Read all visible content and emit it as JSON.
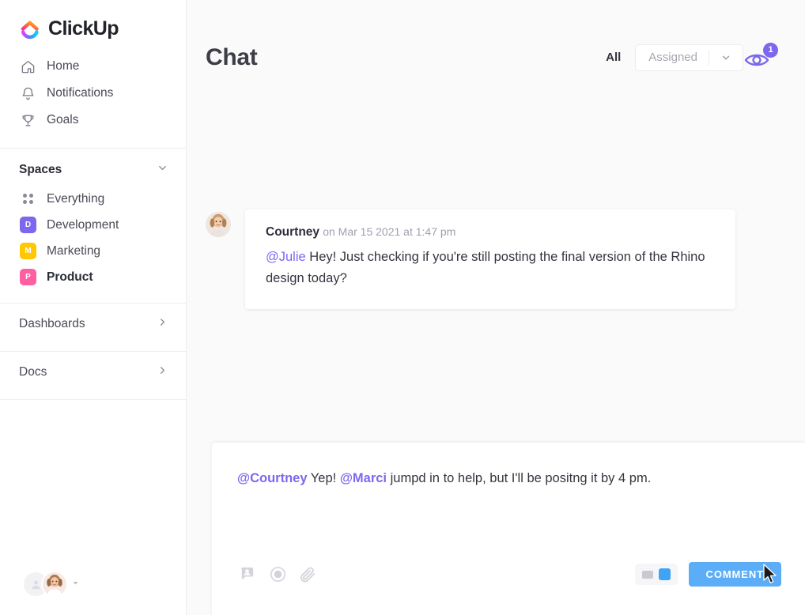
{
  "brand": {
    "name": "ClickUp",
    "logo_icon": "clickup-logo-icon",
    "accent_purple": "#7B68EE",
    "accent_blue": "#5BADF7"
  },
  "sidebar": {
    "nav": [
      {
        "label": "Home",
        "icon": "home-icon"
      },
      {
        "label": "Notifications",
        "icon": "bell-icon"
      },
      {
        "label": "Goals",
        "icon": "trophy-icon"
      }
    ],
    "spaces_header": {
      "label": "Spaces",
      "icon": "chevron-down-icon"
    },
    "spaces": [
      {
        "label": "Everything",
        "icon": "grid-dots-icon",
        "initial": "",
        "color": "",
        "selected": false
      },
      {
        "label": "Development",
        "icon": "space-badge",
        "initial": "D",
        "color": "#7B68EE",
        "selected": false
      },
      {
        "label": "Marketing",
        "icon": "space-badge",
        "initial": "M",
        "color": "#FFC800",
        "selected": false
      },
      {
        "label": "Product",
        "icon": "space-badge",
        "initial": "P",
        "color": "#FF5FA1",
        "selected": true
      }
    ],
    "lists": [
      {
        "label": "Dashboards",
        "icon": "chevron-right-icon"
      },
      {
        "label": "Docs",
        "icon": "chevron-right-icon"
      }
    ],
    "user": {
      "avatar_icon": "user-avatar",
      "caret_icon": "caret-down-icon"
    }
  },
  "header": {
    "title": "Chat",
    "tab_all": "All",
    "filter": {
      "value": "Assigned",
      "caret_icon": "chevron-down-icon"
    },
    "watcher": {
      "icon": "eye-icon",
      "badge": "1"
    }
  },
  "messages": [
    {
      "author": "Courtney",
      "meta": "on Mar 15 2021 at 1:47 pm",
      "avatar_icon": "user-avatar",
      "mention": "@Julie",
      "text": " Hey! Just checking if you're still posting the final version of the Rhino design today?"
    }
  ],
  "composer": {
    "mention_1": "@Courtney",
    "mid_text": " Yep! ",
    "mention_2": "@Marci",
    "tail_text": " jumpd in to help, but I'll be positng it by 4 pm.",
    "tools": [
      {
        "icon": "assign-comment-icon"
      },
      {
        "icon": "record-icon"
      },
      {
        "icon": "attachment-icon"
      }
    ],
    "toggle": {
      "icon": "view-toggle-icon"
    },
    "submit_label": "COMMENT"
  },
  "cursor": {
    "icon": "mouse-pointer-icon"
  }
}
